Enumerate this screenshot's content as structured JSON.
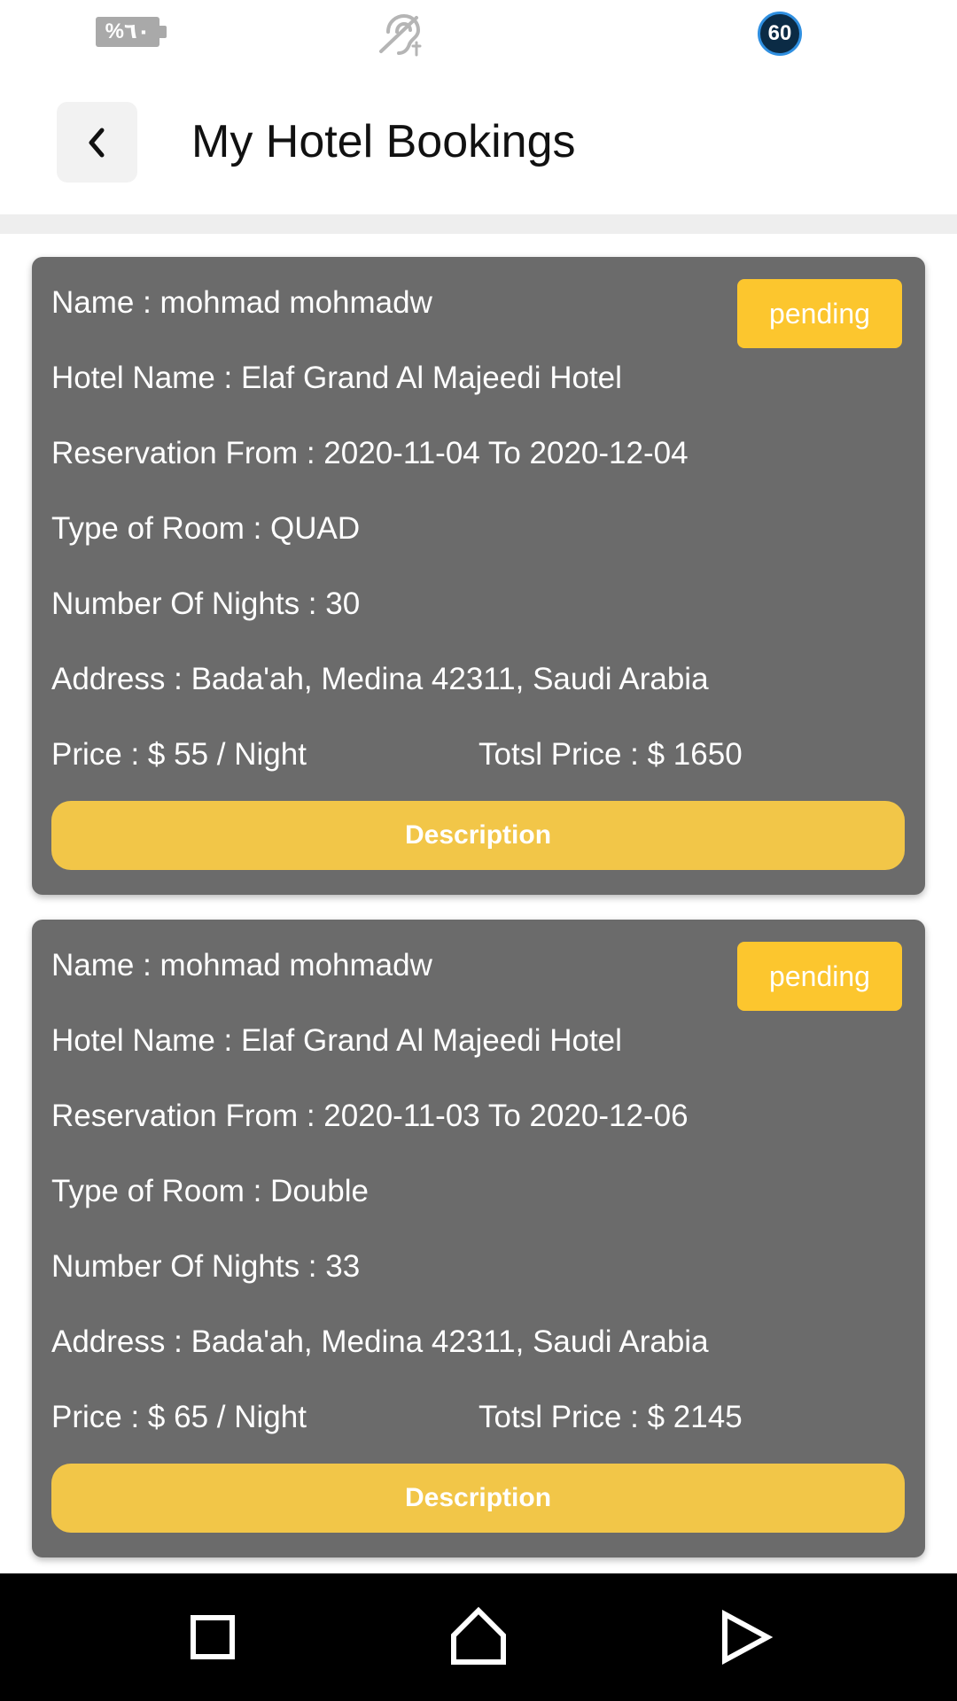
{
  "status_bar": {
    "battery_text": "%٦٠",
    "timer_value": "60",
    "icons": [
      "battery-icon",
      "hearing-aid-icon",
      "timer-badge-icon"
    ]
  },
  "header": {
    "title": "My Hotel Bookings",
    "back_icon": "chevron-left-icon"
  },
  "bookings": [
    {
      "name": "Name : mohmad mohmadw",
      "hotel": "Hotel Name : Elaf Grand Al Majeedi Hotel",
      "reservation": "Reservation From : 2020-11-04 To 2020-12-04",
      "room_type": "Type of Room : QUAD",
      "nights": "Number Of Nights : 30",
      "address": "Address : Bada'ah, Medina 42311, Saudi Arabia",
      "price": "Price : $ 55 / Night",
      "total": "Totsl Price : $ 1650",
      "status": "pending",
      "button_label": "Description"
    },
    {
      "name": "Name : mohmad mohmadw",
      "hotel": "Hotel Name : Elaf Grand Al Majeedi Hotel",
      "reservation": "Reservation From : 2020-11-03 To 2020-12-06",
      "room_type": "Type of Room : Double",
      "nights": "Number Of Nights : 33",
      "address": "Address : Bada'ah, Medina 42311, Saudi Arabia",
      "price": "Price : $ 65 / Night",
      "total": "Totsl Price : $ 2145",
      "status": "pending",
      "button_label": "Description"
    }
  ],
  "nav_bar": {
    "icons": [
      "recents-square-icon",
      "home-icon",
      "back-triangle-icon"
    ]
  },
  "colors": {
    "card_background": "#6b6b6b",
    "accent_yellow": "#f2c648",
    "badge_yellow": "#fcc62e",
    "nav_background": "#000000"
  }
}
